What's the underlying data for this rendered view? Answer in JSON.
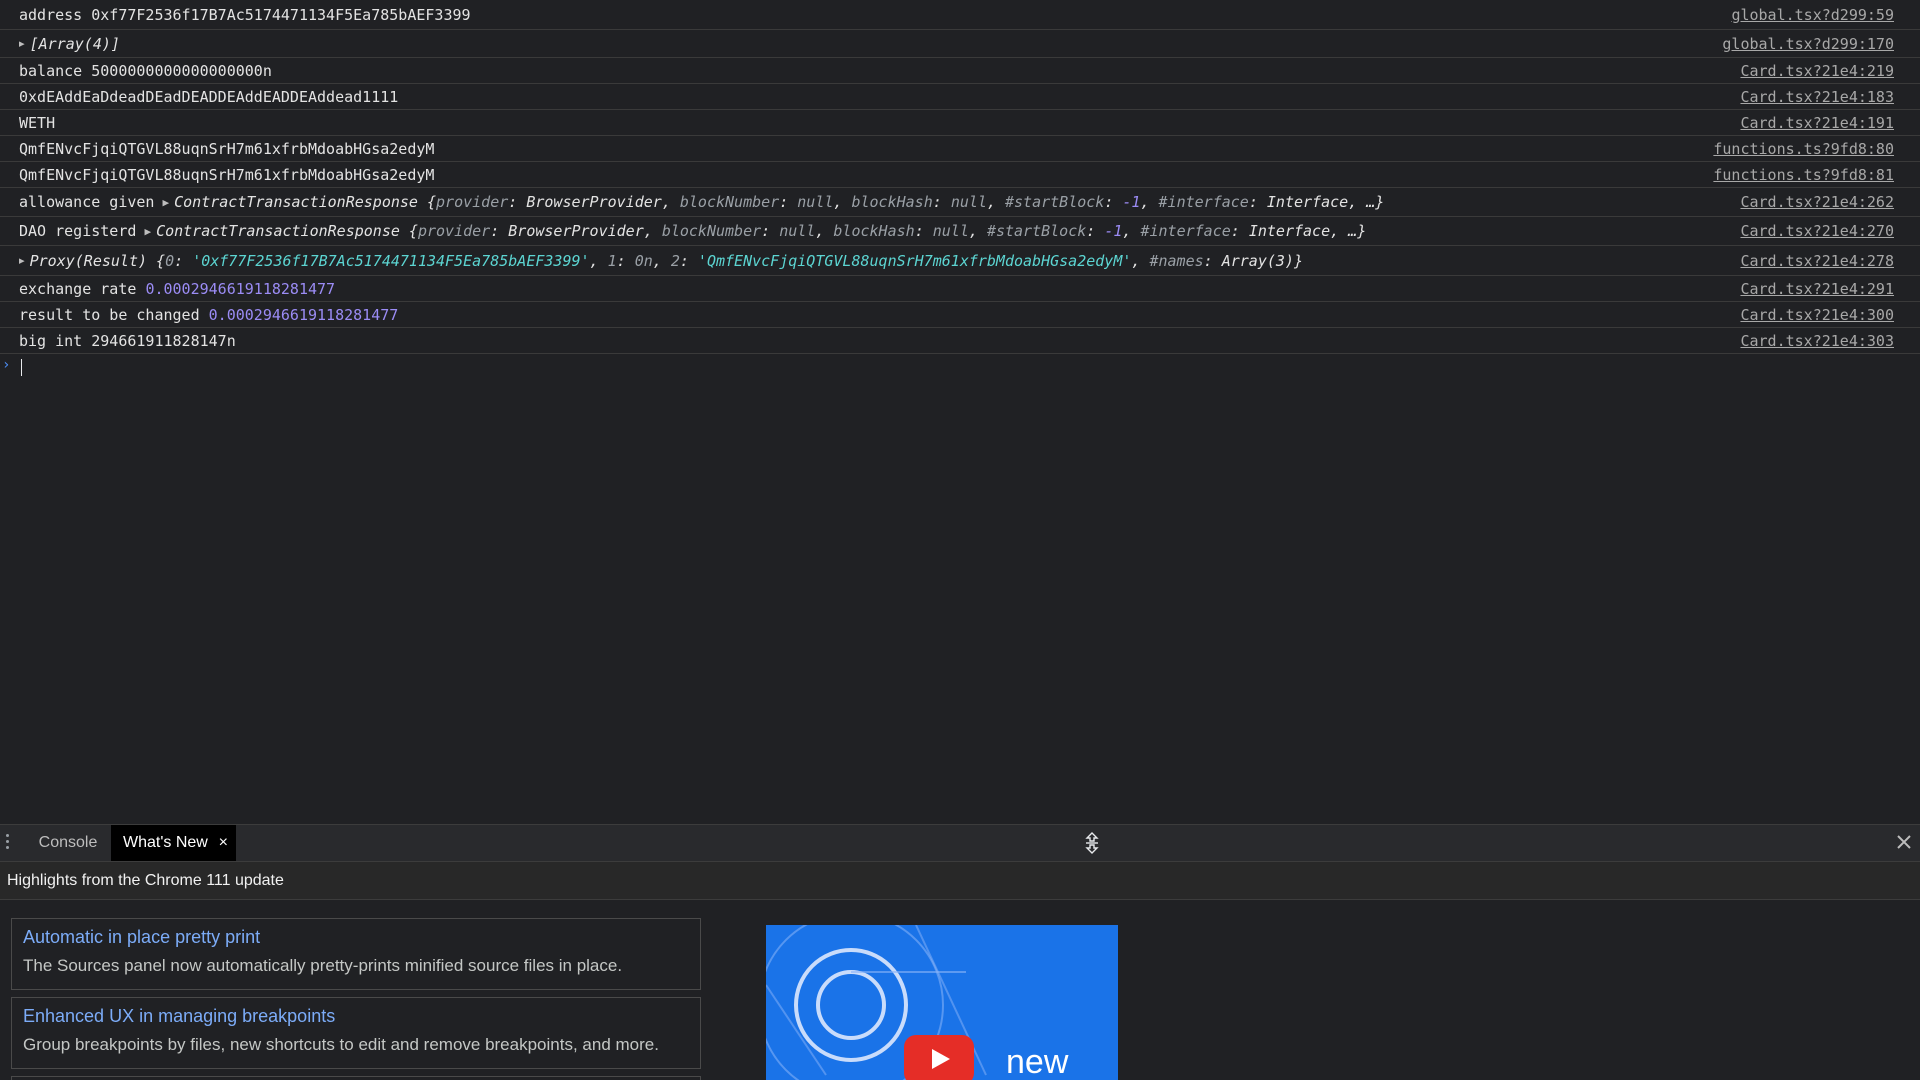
{
  "console": {
    "rows": [
      {
        "text": "address 0xf77F2536f17B7Ac5174471134F5Ea785bAEF3399",
        "source": "global.tsx?d299:59"
      },
      {
        "label": "[Array(4)]",
        "source": "global.tsx?d299:170"
      },
      {
        "text": "balance 5000000000000000000n",
        "source": "Card.tsx?21e4:219"
      },
      {
        "text": "0xdEAddEaDdeadDEadDEADDEAddEADDEAddead1111",
        "source": "Card.tsx?21e4:183"
      },
      {
        "text": "WETH",
        "source": "Card.tsx?21e4:191"
      },
      {
        "text": "QmfENvcFjqiQTGVL88uqnSrH7m61xfrbMdoabHGsa2edyM",
        "source": "functions.ts?9fd8:80"
      },
      {
        "text": "QmfENvcFjqiQTGVL88uqnSrH7m61xfrbMdoabHGsa2edyM",
        "source": "functions.ts?9fd8:81"
      },
      {
        "prefix": "allowance given",
        "object": "ContractTransactionResponse",
        "source": "Card.tsx?21e4:262"
      },
      {
        "prefix": "DAO registerd",
        "object": "ContractTransactionResponse",
        "source": "Card.tsx?21e4:270"
      },
      {
        "proxy_label": "Proxy(Result)",
        "val0": "'0xf77F2536f17B7Ac5174471134F5Ea785bAEF3399'",
        "val1": "0n",
        "val2": "'QmfENvcFjqiQTGVL88uqnSrH7m61xfrbMdoabHGsa2edyM'",
        "names": "Array(3)",
        "source": "Card.tsx?21e4:278"
      },
      {
        "label": "exchange rate",
        "value": "0.00029466191182814​77",
        "source": "Card.tsx?21e4:291"
      },
      {
        "label": "result to be changed",
        "value": "0.0002946619118281477",
        "source": "Card.tsx?21e4:300"
      },
      {
        "text": "big int 294661911828147n",
        "source": "Card.tsx?21e4:303"
      }
    ],
    "response_fields": {
      "provider_key": "provider",
      "provider_val": "BrowserProvider",
      "blocknum_key": "blockNumber",
      "blockhash_key": "blockHash",
      "null_val": "null",
      "startblock_key": "#startBlock",
      "startblock_val": "-1",
      "interface_key": "#interface",
      "interface_val": "Interface",
      "tail": ", …}"
    }
  },
  "drawer": {
    "tabs": {
      "console": "Console",
      "whats_new": "What's New"
    },
    "close_glyph": "×",
    "header": "Highlights from the Chrome 111 update",
    "cards": [
      {
        "title": "Automatic in place pretty print",
        "desc": "The Sources panel now automatically pretty-prints minified source files in place."
      },
      {
        "title": "Enhanced UX in managing breakpoints",
        "desc": "Group breakpoints by files, new shortcuts to edit and remove breakpoints, and more."
      }
    ],
    "video_label": "new"
  },
  "colors": {
    "background": "#202124",
    "link": "#7cacf8",
    "number": "#9b8cf5",
    "string": "#5cd5d2",
    "video_bg": "#1a73e8"
  }
}
